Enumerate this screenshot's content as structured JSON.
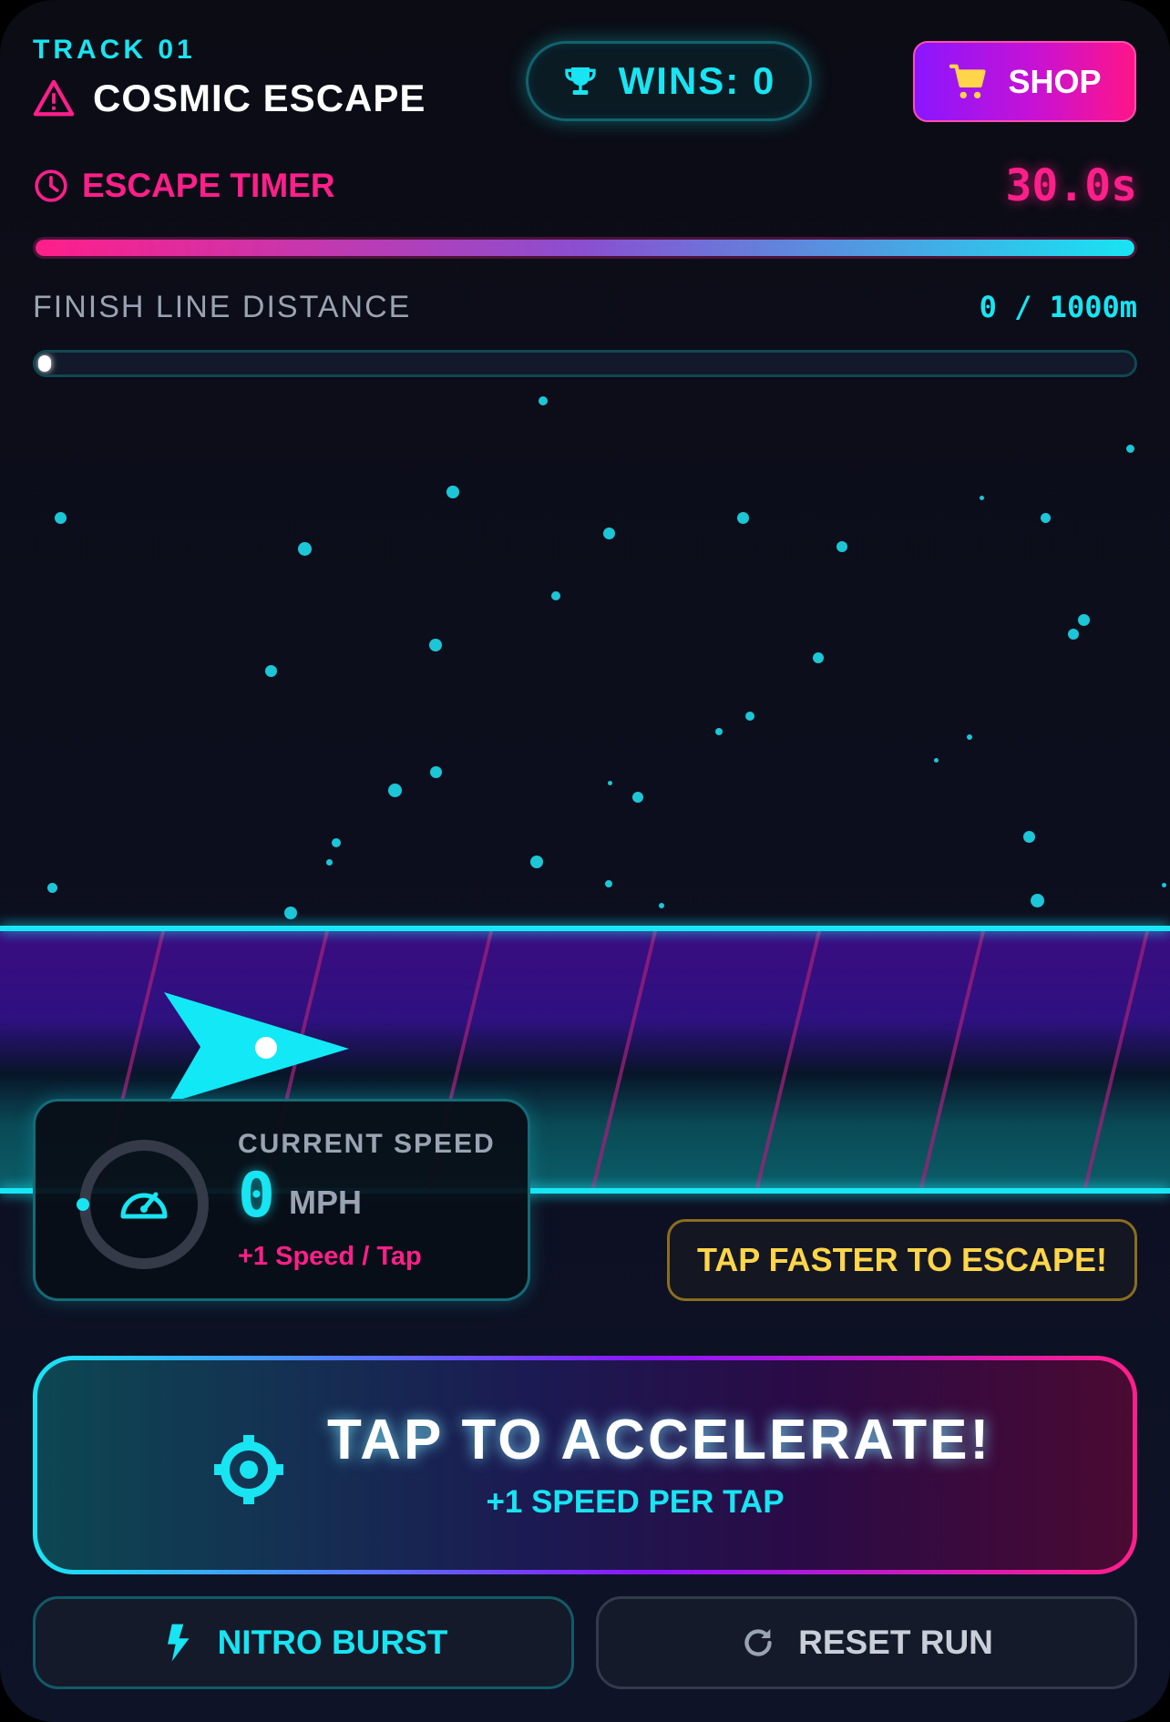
{
  "header": {
    "track_label": "TRACK 01",
    "title": "COSMIC ESCAPE",
    "title_icon": "warning-icon",
    "wins_label": "WINS: 0",
    "wins_icon": "trophy-icon",
    "shop_label": "SHOP",
    "shop_icon": "cart-icon"
  },
  "timer": {
    "label": "ESCAPE TIMER",
    "value": "30.0s",
    "icon": "clock-icon",
    "progress": 1.0
  },
  "distance": {
    "label": "FINISH LINE DISTANCE",
    "value": "0 / 1000m",
    "progress": 0
  },
  "speed": {
    "label": "CURRENT SPEED",
    "value": "0",
    "unit": "MPH",
    "tap_note": "+1 Speed / Tap",
    "icon": "speedometer-icon"
  },
  "hint": {
    "text": "TAP FASTER TO ESCAPE!"
  },
  "tap_button": {
    "title": "TAP TO ACCELERATE!",
    "subtitle": "+1 SPEED PER TAP",
    "icon": "crosshair-icon"
  },
  "actions": {
    "nitro_label": "NITRO BURST",
    "nitro_icon": "bolt-icon",
    "reset_label": "RESET RUN",
    "reset_icon": "refresh-icon"
  },
  "colors": {
    "cyan": "#18e4f2",
    "pink": "#ff1f8a",
    "purple": "#8a16ff",
    "yellow": "#ffd54a",
    "background": "#0b0c14"
  }
}
